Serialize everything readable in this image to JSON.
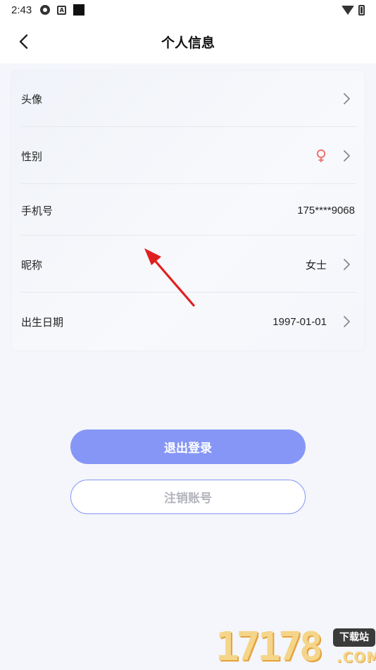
{
  "status_bar": {
    "time": "2:43",
    "icons": [
      "settings-gear-icon",
      "a-box-icon",
      "black-square-icon",
      "wifi-icon",
      "battery-icon"
    ]
  },
  "header": {
    "title": "个人信息",
    "back_icon": "chevron-left-icon"
  },
  "profile_rows": [
    {
      "label": "头像",
      "value": "",
      "has_chevron": true
    },
    {
      "label": "性别",
      "value": "",
      "icon": "female-icon",
      "icon_color": "#f06a6a",
      "has_chevron": true
    },
    {
      "label": "手机号",
      "value": "175****9068",
      "has_chevron": false
    },
    {
      "label": "昵称",
      "value": "女士",
      "has_chevron": true
    },
    {
      "label": "出生日期",
      "value": "1997-01-01",
      "has_chevron": true
    }
  ],
  "actions": {
    "logout_label": "退出登录",
    "cancel_account_label": "注销账号"
  },
  "colors": {
    "accent": "#8696f6",
    "annotation_arrow": "#e02020",
    "background": "#f4f6fb"
  },
  "watermark": {
    "digits": "17178",
    "badge": "下载站",
    "suffix": ".COM"
  }
}
